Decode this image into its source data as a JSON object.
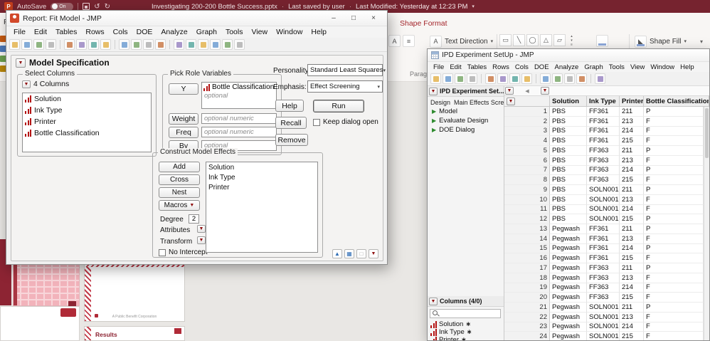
{
  "icons": {
    "red_triangle": "▼",
    "caret_down": "▾",
    "caret_up": "▴",
    "collapse_left": "◀",
    "script_arrow": "▶",
    "asterisk": "∗",
    "window_min": "–",
    "window_max": "□",
    "window_close": "×",
    "undo": "↺",
    "redo": "↻",
    "more_lines": "≡",
    "grid": "▦",
    "up_arrow": "▲",
    "dot": "·"
  },
  "powerpoint": {
    "titlebar": {
      "autosave_label": "AutoSave",
      "autosave_state": "On",
      "document_title": "Investigating 200-200 Bottle Success.pptx",
      "saved_status": "Last saved by user",
      "modified_status": "Last Modified: Yesterday at 12:23 PM"
    },
    "ribbon": {
      "file_tab": "File",
      "active_tab": "Shape Format",
      "text_direction_label": "Text Direction",
      "shape_fill_label": "Shape Fill",
      "paragraph_group_label": "Paragraph"
    },
    "slides": {
      "results_slide_title": "Results",
      "footer_slide_text": "A Public Benefit Corporation"
    }
  },
  "fit_model": {
    "window_title": "Report: Fit Model - JMP",
    "menus": [
      "File",
      "Edit",
      "Tables",
      "Rows",
      "Cols",
      "DOE",
      "Analyze",
      "Graph",
      "Tools",
      "View",
      "Window",
      "Help"
    ],
    "panel_title": "Model Specification",
    "select_columns": {
      "label": "Select Columns",
      "count_label": "4 Columns",
      "items": [
        "Solution",
        "Ink Type",
        "Printer",
        "Bottle Classification"
      ]
    },
    "pick_roles": {
      "label": "Pick Role Variables",
      "y_button": "Y",
      "y_value": "Bottle Classification",
      "y_hint": "optional",
      "weight_button": "Weight",
      "weight_hint": "optional numeric",
      "freq_button": "Freq",
      "freq_hint": "optional numeric",
      "by_button": "By",
      "by_hint": "optional"
    },
    "personality": {
      "label": "Personality:",
      "value": "Standard Least Squares"
    },
    "emphasis": {
      "label": "Emphasis:",
      "value": "Effect Screening"
    },
    "actions": {
      "help": "Help",
      "run": "Run",
      "recall": "Recall",
      "keep_dialog_open": "Keep dialog open",
      "remove": "Remove"
    },
    "effects": {
      "label": "Construct Model Effects",
      "add_button": "Add",
      "cross_button": "Cross",
      "nest_button": "Nest",
      "macros_button": "Macros",
      "degree_label": "Degree",
      "degree_value": "2",
      "attributes_label": "Attributes",
      "transform_label": "Transform",
      "no_intercept_label": "No Intercept",
      "items": [
        "Solution",
        "Ink Type",
        "Printer"
      ]
    }
  },
  "data_window": {
    "window_title": "IPD Experiment SetUp - JMP",
    "menus": [
      "File",
      "Edit",
      "Tables",
      "Rows",
      "Cols",
      "DOE",
      "Analyze",
      "Graph",
      "Tools",
      "View",
      "Window",
      "Help"
    ],
    "side_panel": {
      "table_title": "IPD Experiment Set...",
      "design_label": "Design",
      "design_value": "Main Effects Scree",
      "scripts": [
        "Model",
        "Evaluate Design",
        "DOE Dialog"
      ],
      "columns_title": "Columns (4/0)",
      "columns": [
        "Solution",
        "Ink Type",
        "Printer"
      ]
    },
    "table": {
      "columns": [
        "Solution",
        "Ink Type",
        "Printer",
        "Bottle Classification"
      ],
      "rows": [
        [
          1,
          "PBS",
          "FF361",
          "211",
          "P"
        ],
        [
          2,
          "PBS",
          "FF361",
          "213",
          "F"
        ],
        [
          3,
          "PBS",
          "FF361",
          "214",
          "F"
        ],
        [
          4,
          "PBS",
          "FF361",
          "215",
          "F"
        ],
        [
          5,
          "PBS",
          "FF363",
          "211",
          "P"
        ],
        [
          6,
          "PBS",
          "FF363",
          "213",
          "F"
        ],
        [
          7,
          "PBS",
          "FF363",
          "214",
          "P"
        ],
        [
          8,
          "PBS",
          "FF363",
          "215",
          "F"
        ],
        [
          9,
          "PBS",
          "SOLN001",
          "211",
          "P"
        ],
        [
          10,
          "PBS",
          "SOLN001",
          "213",
          "F"
        ],
        [
          11,
          "PBS",
          "SOLN001",
          "214",
          "F"
        ],
        [
          12,
          "PBS",
          "SOLN001",
          "215",
          "P"
        ],
        [
          13,
          "Pegwash",
          "FF361",
          "211",
          "P"
        ],
        [
          14,
          "Pegwash",
          "FF361",
          "213",
          "F"
        ],
        [
          15,
          "Pegwash",
          "FF361",
          "214",
          "P"
        ],
        [
          16,
          "Pegwash",
          "FF361",
          "215",
          "F"
        ],
        [
          17,
          "Pegwash",
          "FF363",
          "211",
          "P"
        ],
        [
          18,
          "Pegwash",
          "FF363",
          "213",
          "F"
        ],
        [
          19,
          "Pegwash",
          "FF363",
          "214",
          "F"
        ],
        [
          20,
          "Pegwash",
          "FF363",
          "215",
          "F"
        ],
        [
          21,
          "Pegwash",
          "SOLN001",
          "211",
          "P"
        ],
        [
          22,
          "Pegwash",
          "SOLN001",
          "213",
          "F"
        ],
        [
          23,
          "Pegwash",
          "SOLN001",
          "214",
          "F"
        ],
        [
          24,
          "Pegwash",
          "SOLN001",
          "215",
          "F"
        ]
      ]
    }
  }
}
